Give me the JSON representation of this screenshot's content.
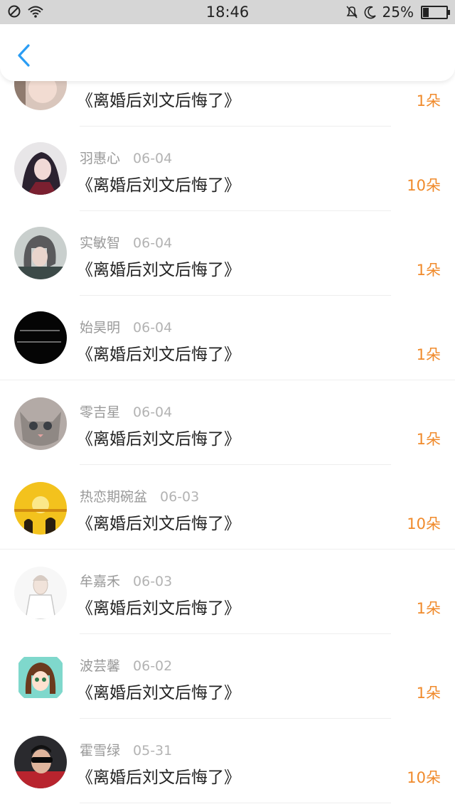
{
  "status_bar": {
    "time": "18:46",
    "battery": "25%",
    "battery_level": 0.25
  },
  "nav": {
    "back_icon": "chevron-left-icon",
    "accent": "#2a9df4"
  },
  "items": [
    {
      "name": "",
      "date": "",
      "title": "《离婚后刘文后悔了》",
      "gift": "1朵",
      "avatar": "girl-photo"
    },
    {
      "name": "羽惠心",
      "date": "06-04",
      "title": "《离婚后刘文后悔了》",
      "gift": "10朵",
      "avatar": "anime-boy"
    },
    {
      "name": "实敏智",
      "date": "06-04",
      "title": "《离婚后刘文后悔了》",
      "gift": "1朵",
      "avatar": "bob-hair-girl"
    },
    {
      "name": "始昊明",
      "date": "06-04",
      "title": "《离婚后刘文后悔了》",
      "gift": "1朵",
      "avatar": "black-text"
    },
    {
      "name": "零吉星",
      "date": "06-04",
      "title": "《离婚后刘文后悔了》",
      "gift": "1朵",
      "avatar": "kitten"
    },
    {
      "name": "热恋期碗盆",
      "date": "06-03",
      "title": "《离婚后刘文后悔了》",
      "gift": "10朵",
      "avatar": "sunset-couple"
    },
    {
      "name": "牟嘉禾",
      "date": "06-03",
      "title": "《离婚后刘文后悔了》",
      "gift": "1朵",
      "avatar": "sketch-boy"
    },
    {
      "name": "波芸馨",
      "date": "06-02",
      "title": "《离婚后刘文后悔了》",
      "gift": "1朵",
      "avatar": "cartoon-girl"
    },
    {
      "name": "霍雪绿",
      "date": "05-31",
      "title": "《离婚后刘文后悔了》",
      "gift": "10朵",
      "avatar": "sunglasses-man"
    }
  ]
}
